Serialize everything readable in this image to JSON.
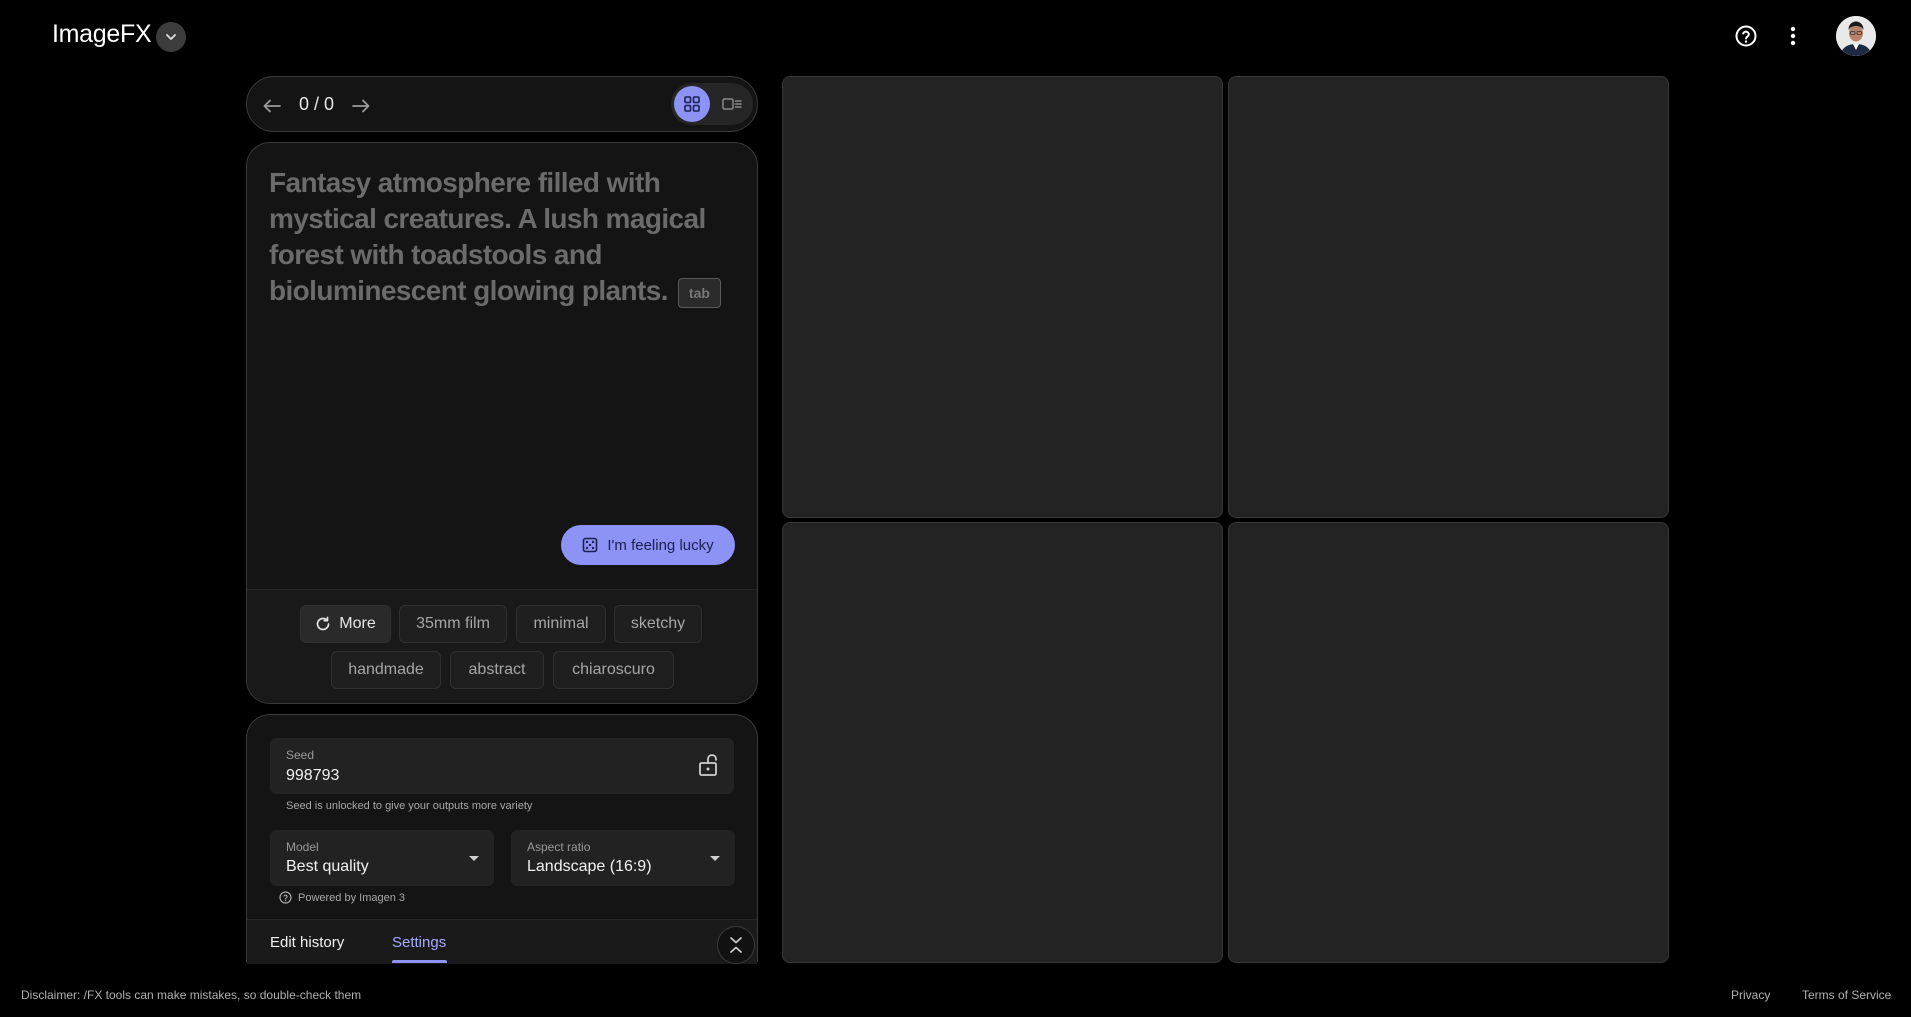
{
  "header": {
    "app_title": "ImageFX",
    "icons": {
      "switcher": "chevron-down-icon",
      "help": "help-circle-icon",
      "more": "more-vert-icon",
      "avatar": "user-avatar"
    }
  },
  "nav": {
    "counter": "0 / 0",
    "icons": {
      "prev": "arrow-left-icon",
      "next": "arrow-right-icon",
      "grid_view": "grid-view-icon",
      "detail_view": "detail-view-icon"
    }
  },
  "prompt": {
    "text": "Fantasy atmosphere filled with mystical creatures. A lush magical forest with toadstools and bioluminescent glowing plants.",
    "tab_hint": "tab",
    "lucky_label": "I'm feeling lucky",
    "lucky_icon": "dice-icon"
  },
  "chips": {
    "more_label": "More",
    "more_icon": "refresh-icon",
    "items": [
      "35mm film",
      "minimal",
      "sketchy",
      "handmade",
      "abstract",
      "chiaroscuro"
    ]
  },
  "settings": {
    "seed_label": "Seed",
    "seed_value": "998793",
    "seed_icon": "unlock-icon",
    "seed_helper": "Seed is unlocked to give your outputs more variety",
    "model_label": "Model",
    "model_value": "Best quality",
    "aspect_label": "Aspect ratio",
    "aspect_value": "Landscape (16:9)",
    "powered_by": "Powered by Imagen 3",
    "tabs": [
      "Edit history",
      "Settings"
    ],
    "active_tab": "Settings"
  },
  "footer": {
    "disclaimer": "Disclaimer: /FX tools can make mistakes, so double-check them",
    "privacy": "Privacy",
    "terms": "Terms of Service"
  },
  "colors": {
    "accent": "#8c93f5",
    "background": "#000000",
    "panel": "#141414",
    "image_placeholder": "#232323"
  }
}
